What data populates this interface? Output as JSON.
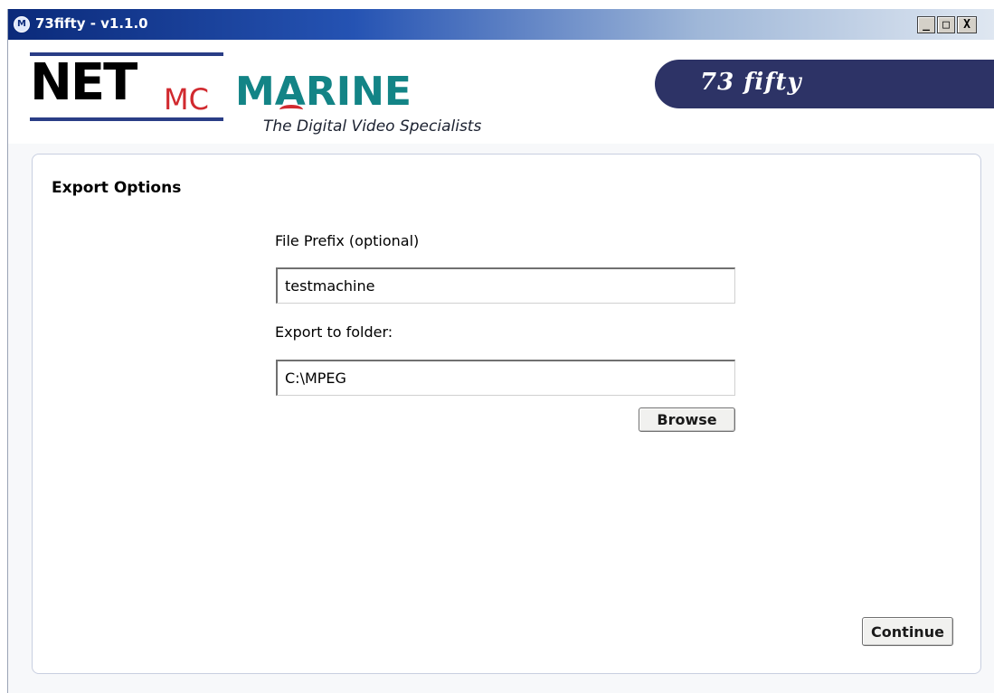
{
  "window": {
    "title": "73fifty - v1.1.0",
    "icon": "app-logo-icon",
    "controls": {
      "minimize": "_",
      "maximize": "□",
      "close": "X"
    }
  },
  "header": {
    "logo": {
      "net": "NET",
      "mc": "MC",
      "marine": "MARINE",
      "tagline": "The Digital Video Specialists"
    },
    "product_badge": "73 fifty",
    "colors": {
      "net": "#000000",
      "mc": "#d12a2f",
      "marine": "#138486",
      "badge_bg": "#2d3366"
    }
  },
  "panel": {
    "title": "Export Options",
    "file_prefix": {
      "label": "File Prefix (optional)",
      "value": "testmachine"
    },
    "export_folder": {
      "label": "Export to folder:",
      "value": "C:\\MPEG"
    },
    "browse_label": "Browse",
    "continue_label": "Continue"
  }
}
